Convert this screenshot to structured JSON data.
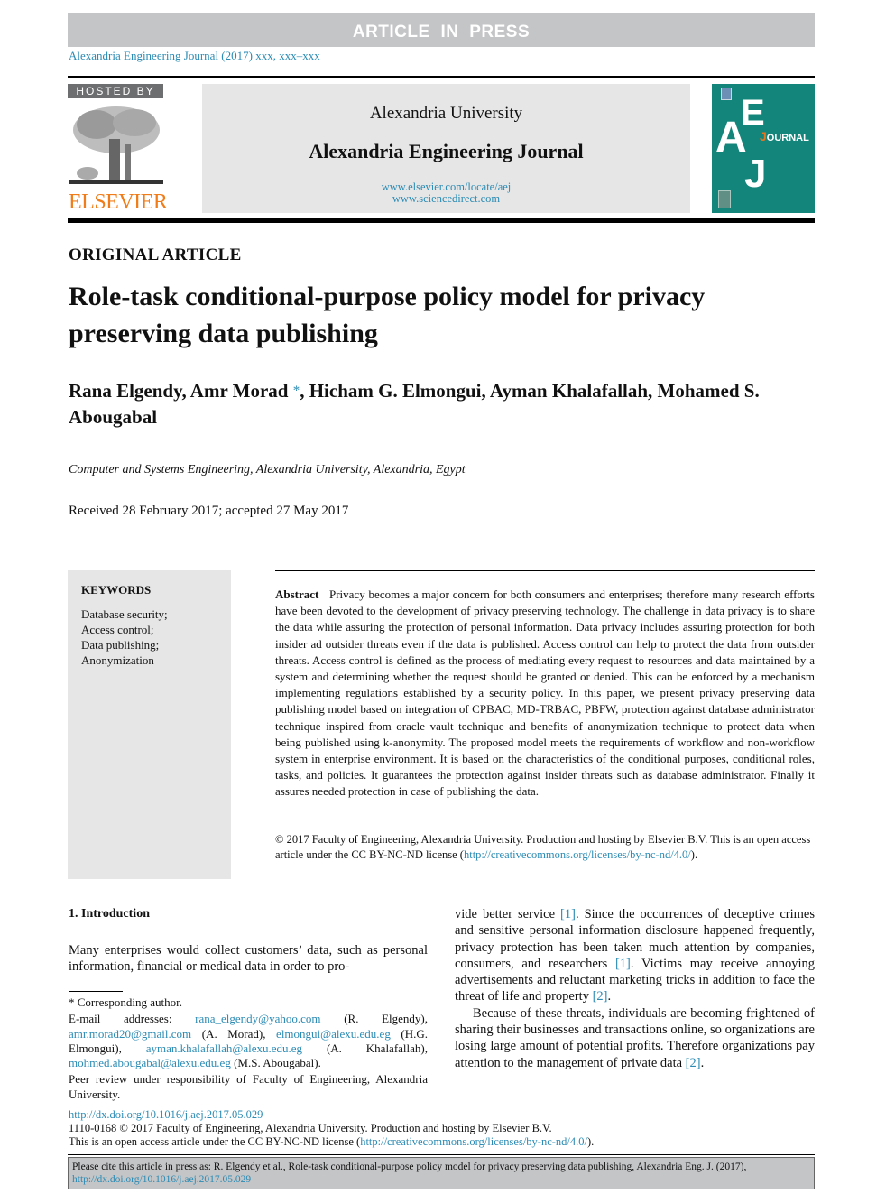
{
  "header": {
    "press_label": "ARTICLE IN PRESS",
    "journal_ref": "Alexandria Engineering Journal (2017) xxx, xxx–xxx",
    "hosted_by": "HOSTED BY",
    "publisher_logo_text": "ELSEVIER",
    "university": "Alexandria University",
    "journal_name": "Alexandria Engineering Journal",
    "url1": "www.elsevier.com/locate/aej",
    "url2": "www.sciencedirect.com",
    "cover": {
      "letters": [
        "A",
        "E",
        "J"
      ],
      "journal_word_initial": "J",
      "journal_word_rest": "OURNAL",
      "bg_color": "#14857a",
      "accent_color": "#e8741e"
    }
  },
  "article": {
    "type": "ORIGINAL ARTICLE",
    "title": "Role-task conditional-purpose policy model for privacy preserving data publishing",
    "authors_before_star": "Rana Elgendy, Amr Morad",
    "corresponding_mark": "*",
    "authors_after_star": ", Hicham G. Elmongui, Ayman Khalafallah, Mohamed S. Abougabal",
    "affiliation": "Computer and Systems Engineering, Alexandria University, Alexandria, Egypt",
    "dates": "Received 28 February 2017; accepted 27 May 2017"
  },
  "keywords": {
    "heading": "KEYWORDS",
    "items": [
      "Database security;",
      "Access control;",
      "Data publishing;",
      "Anonymization"
    ]
  },
  "abstract": {
    "label": "Abstract",
    "text": "Privacy becomes a major concern for both consumers and enterprises; therefore many research efforts have been devoted to the development of privacy preserving technology. The challenge in data privacy is to share the data while assuring the protection of personal information. Data privacy includes assuring protection for both insider ad outsider threats even if the data is published. Access control can help to protect the data from outsider threats. Access control is defined as the process of mediating every request to resources and data maintained by a system and determining whether the request should be granted or denied. This can be enforced by a mechanism implementing regulations established by a security policy. In this paper, we present privacy preserving data publishing model based on integration of CPBAC, MD-TRBAC, PBFW, protection against database administrator technique inspired from oracle vault technique and benefits of anonymization technique to protect data when being published using k-anonymity. The proposed model meets the requirements of workflow and non-workflow system in enterprise environment. It is based on the characteristics of the conditional purposes, conditional roles, tasks, and policies. It guarantees the protection against insider threats such as database administrator. Finally it assures needed protection in case of publishing the data.",
    "copyright_text": "© 2017 Faculty of Engineering, Alexandria University. Production and hosting by Elsevier B.V. This is an open access article under the CC BY-NC-ND license (",
    "license_url": "http://creativecommons.org/licenses/by-nc-nd/4.0/",
    "copyright_close": ")."
  },
  "introduction": {
    "heading": "1. Introduction",
    "p1": "Many enterprises would collect customers’ data, such as personal information, financial or medical data in order to pro-",
    "col2_p1_a": "vide better service ",
    "ref1": "[1]",
    "col2_p1_b": ". Since the occurrences of deceptive crimes and sensitive personal information disclosure happened frequently, privacy protection has been taken much attention by companies, consumers, and researchers ",
    "col2_p1_c": ". Victims may receive annoying advertisements and reluctant marketing tricks in addition to face the threat of life and property ",
    "ref2": "[2]",
    "col2_p1_d": ".",
    "col2_p2_a": "Because of these threats, individuals are becoming frightened of sharing their businesses and transactions online, so organizations are losing large amount of potential profits. Therefore organizations pay attention to the management of private data ",
    "col2_p2_b": "."
  },
  "footnotes": {
    "corresponding": "* Corresponding author.",
    "email_label": "E-mail addresses: ",
    "emails": [
      {
        "address": "rana_elgendy@yahoo.com",
        "name": " (R. Elgendy), "
      },
      {
        "address": "amr.morad20@gmail.com",
        "name": " (A. Morad), "
      },
      {
        "address": "elmongui@alexu.edu.eg",
        "name": " (H.G. Elmongui), "
      },
      {
        "address": "ayman.khalafallah@alexu.edu.eg",
        "name": " (A. Khalafallah), "
      },
      {
        "address": "mohmed.abougabal@alexu.edu.eg",
        "name": " (M.S. Abougabal)."
      }
    ],
    "peer_review": "Peer review under responsibility of Faculty of Engineering, Alexandria University."
  },
  "footer": {
    "doi_url": "http://dx.doi.org/10.1016/j.aej.2017.05.029",
    "issn_line": "1110-0168 © 2017 Faculty of Engineering, Alexandria University. Production and hosting by Elsevier B.V.",
    "license_line_a": "This is an open access article under the CC BY-NC-ND license (",
    "license_url": "http://creativecommons.org/licenses/by-nc-nd/4.0/",
    "license_line_b": ").",
    "cite_text": "Please cite this article in press as: R. Elgendy et al., Role-task conditional-purpose policy model for privacy preserving data publishing,  Alexandria Eng. J. (2017),",
    "cite_doi": "http://dx.doi.org/10.1016/j.aej.2017.05.029"
  }
}
